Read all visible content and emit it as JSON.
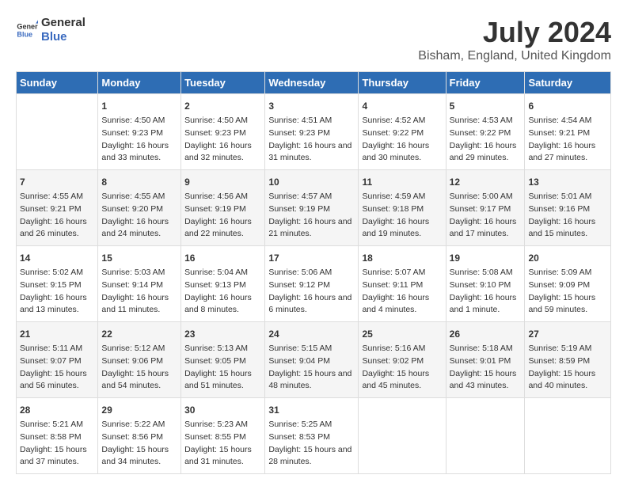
{
  "logo": {
    "general": "General",
    "blue": "Blue"
  },
  "title": "July 2024",
  "subtitle": "Bisham, England, United Kingdom",
  "headers": [
    "Sunday",
    "Monday",
    "Tuesday",
    "Wednesday",
    "Thursday",
    "Friday",
    "Saturday"
  ],
  "weeks": [
    [
      {
        "day": "",
        "sunrise": "",
        "sunset": "",
        "daylight": ""
      },
      {
        "day": "1",
        "sunrise": "Sunrise: 4:50 AM",
        "sunset": "Sunset: 9:23 PM",
        "daylight": "Daylight: 16 hours and 33 minutes."
      },
      {
        "day": "2",
        "sunrise": "Sunrise: 4:50 AM",
        "sunset": "Sunset: 9:23 PM",
        "daylight": "Daylight: 16 hours and 32 minutes."
      },
      {
        "day": "3",
        "sunrise": "Sunrise: 4:51 AM",
        "sunset": "Sunset: 9:23 PM",
        "daylight": "Daylight: 16 hours and 31 minutes."
      },
      {
        "day": "4",
        "sunrise": "Sunrise: 4:52 AM",
        "sunset": "Sunset: 9:22 PM",
        "daylight": "Daylight: 16 hours and 30 minutes."
      },
      {
        "day": "5",
        "sunrise": "Sunrise: 4:53 AM",
        "sunset": "Sunset: 9:22 PM",
        "daylight": "Daylight: 16 hours and 29 minutes."
      },
      {
        "day": "6",
        "sunrise": "Sunrise: 4:54 AM",
        "sunset": "Sunset: 9:21 PM",
        "daylight": "Daylight: 16 hours and 27 minutes."
      }
    ],
    [
      {
        "day": "7",
        "sunrise": "Sunrise: 4:55 AM",
        "sunset": "Sunset: 9:21 PM",
        "daylight": "Daylight: 16 hours and 26 minutes."
      },
      {
        "day": "8",
        "sunrise": "Sunrise: 4:55 AM",
        "sunset": "Sunset: 9:20 PM",
        "daylight": "Daylight: 16 hours and 24 minutes."
      },
      {
        "day": "9",
        "sunrise": "Sunrise: 4:56 AM",
        "sunset": "Sunset: 9:19 PM",
        "daylight": "Daylight: 16 hours and 22 minutes."
      },
      {
        "day": "10",
        "sunrise": "Sunrise: 4:57 AM",
        "sunset": "Sunset: 9:19 PM",
        "daylight": "Daylight: 16 hours and 21 minutes."
      },
      {
        "day": "11",
        "sunrise": "Sunrise: 4:59 AM",
        "sunset": "Sunset: 9:18 PM",
        "daylight": "Daylight: 16 hours and 19 minutes."
      },
      {
        "day": "12",
        "sunrise": "Sunrise: 5:00 AM",
        "sunset": "Sunset: 9:17 PM",
        "daylight": "Daylight: 16 hours and 17 minutes."
      },
      {
        "day": "13",
        "sunrise": "Sunrise: 5:01 AM",
        "sunset": "Sunset: 9:16 PM",
        "daylight": "Daylight: 16 hours and 15 minutes."
      }
    ],
    [
      {
        "day": "14",
        "sunrise": "Sunrise: 5:02 AM",
        "sunset": "Sunset: 9:15 PM",
        "daylight": "Daylight: 16 hours and 13 minutes."
      },
      {
        "day": "15",
        "sunrise": "Sunrise: 5:03 AM",
        "sunset": "Sunset: 9:14 PM",
        "daylight": "Daylight: 16 hours and 11 minutes."
      },
      {
        "day": "16",
        "sunrise": "Sunrise: 5:04 AM",
        "sunset": "Sunset: 9:13 PM",
        "daylight": "Daylight: 16 hours and 8 minutes."
      },
      {
        "day": "17",
        "sunrise": "Sunrise: 5:06 AM",
        "sunset": "Sunset: 9:12 PM",
        "daylight": "Daylight: 16 hours and 6 minutes."
      },
      {
        "day": "18",
        "sunrise": "Sunrise: 5:07 AM",
        "sunset": "Sunset: 9:11 PM",
        "daylight": "Daylight: 16 hours and 4 minutes."
      },
      {
        "day": "19",
        "sunrise": "Sunrise: 5:08 AM",
        "sunset": "Sunset: 9:10 PM",
        "daylight": "Daylight: 16 hours and 1 minute."
      },
      {
        "day": "20",
        "sunrise": "Sunrise: 5:09 AM",
        "sunset": "Sunset: 9:09 PM",
        "daylight": "Daylight: 15 hours and 59 minutes."
      }
    ],
    [
      {
        "day": "21",
        "sunrise": "Sunrise: 5:11 AM",
        "sunset": "Sunset: 9:07 PM",
        "daylight": "Daylight: 15 hours and 56 minutes."
      },
      {
        "day": "22",
        "sunrise": "Sunrise: 5:12 AM",
        "sunset": "Sunset: 9:06 PM",
        "daylight": "Daylight: 15 hours and 54 minutes."
      },
      {
        "day": "23",
        "sunrise": "Sunrise: 5:13 AM",
        "sunset": "Sunset: 9:05 PM",
        "daylight": "Daylight: 15 hours and 51 minutes."
      },
      {
        "day": "24",
        "sunrise": "Sunrise: 5:15 AM",
        "sunset": "Sunset: 9:04 PM",
        "daylight": "Daylight: 15 hours and 48 minutes."
      },
      {
        "day": "25",
        "sunrise": "Sunrise: 5:16 AM",
        "sunset": "Sunset: 9:02 PM",
        "daylight": "Daylight: 15 hours and 45 minutes."
      },
      {
        "day": "26",
        "sunrise": "Sunrise: 5:18 AM",
        "sunset": "Sunset: 9:01 PM",
        "daylight": "Daylight: 15 hours and 43 minutes."
      },
      {
        "day": "27",
        "sunrise": "Sunrise: 5:19 AM",
        "sunset": "Sunset: 8:59 PM",
        "daylight": "Daylight: 15 hours and 40 minutes."
      }
    ],
    [
      {
        "day": "28",
        "sunrise": "Sunrise: 5:21 AM",
        "sunset": "Sunset: 8:58 PM",
        "daylight": "Daylight: 15 hours and 37 minutes."
      },
      {
        "day": "29",
        "sunrise": "Sunrise: 5:22 AM",
        "sunset": "Sunset: 8:56 PM",
        "daylight": "Daylight: 15 hours and 34 minutes."
      },
      {
        "day": "30",
        "sunrise": "Sunrise: 5:23 AM",
        "sunset": "Sunset: 8:55 PM",
        "daylight": "Daylight: 15 hours and 31 minutes."
      },
      {
        "day": "31",
        "sunrise": "Sunrise: 5:25 AM",
        "sunset": "Sunset: 8:53 PM",
        "daylight": "Daylight: 15 hours and 28 minutes."
      },
      {
        "day": "",
        "sunrise": "",
        "sunset": "",
        "daylight": ""
      },
      {
        "day": "",
        "sunrise": "",
        "sunset": "",
        "daylight": ""
      },
      {
        "day": "",
        "sunrise": "",
        "sunset": "",
        "daylight": ""
      }
    ]
  ]
}
